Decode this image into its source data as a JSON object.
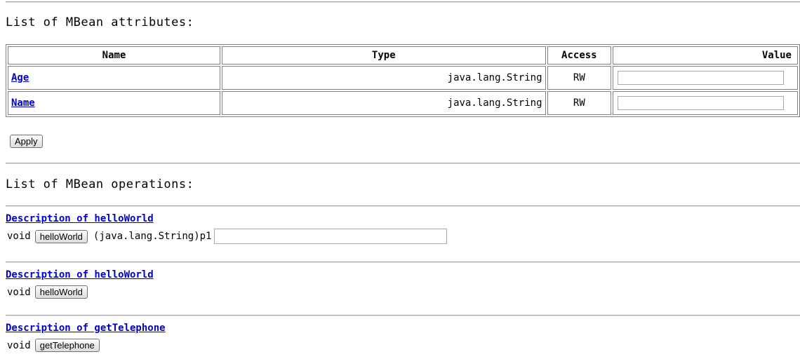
{
  "attributes_section": {
    "heading": "List of MBean attributes:",
    "columns": {
      "name": "Name",
      "type": "Type",
      "access": "Access",
      "value": "Value"
    },
    "rows": [
      {
        "name": "Age",
        "type": "java.lang.String",
        "access": "RW",
        "value": ""
      },
      {
        "name": "Name",
        "type": "java.lang.String",
        "access": "RW",
        "value": ""
      }
    ],
    "apply_label": "Apply"
  },
  "operations_section": {
    "heading": "List of MBean operations:",
    "operations": [
      {
        "description": "Description of helloWorld",
        "return_type": "void",
        "button": "helloWorld",
        "param_label": "(java.lang.String)p1",
        "param_value": ""
      },
      {
        "description": "Description of helloWorld",
        "return_type": "void",
        "button": "helloWorld"
      },
      {
        "description": "Description of getTelephone",
        "return_type": "void",
        "button": "getTelephone"
      }
    ]
  },
  "colors": {
    "link": "#0000cc",
    "rule": "#a0a0a0"
  }
}
